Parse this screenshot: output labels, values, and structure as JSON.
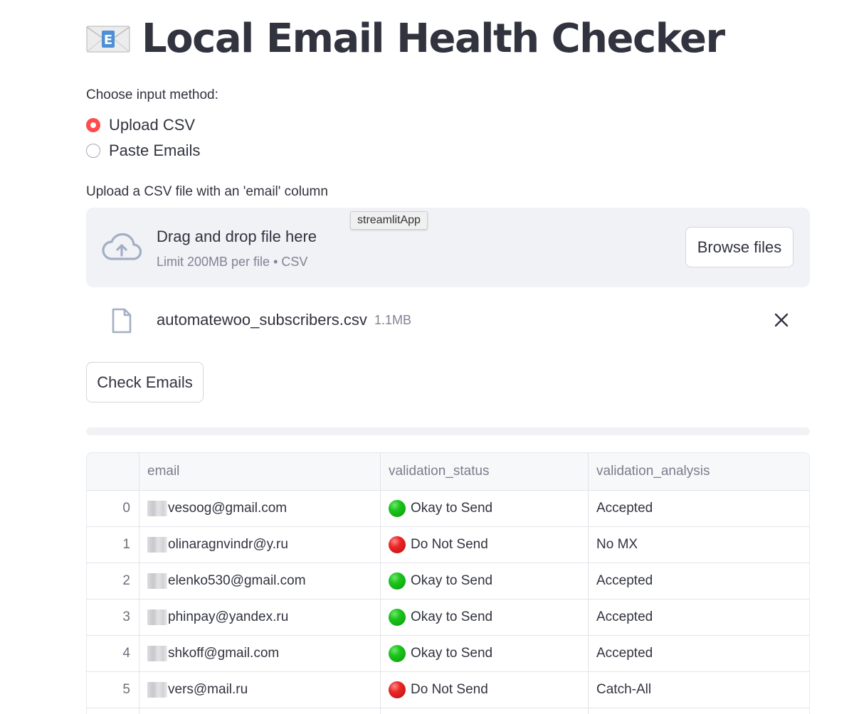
{
  "header": {
    "title": "Local Email Health Checker",
    "icon": "envelope-icon"
  },
  "input_method": {
    "label": "Choose input method:",
    "options": [
      {
        "label": "Upload CSV",
        "selected": true
      },
      {
        "label": "Paste Emails",
        "selected": false
      }
    ]
  },
  "uploader": {
    "label": "Upload a CSV file with an 'email' column",
    "drop_title": "Drag and drop file here",
    "drop_subtitle": "Limit 200MB per file • CSV",
    "browse_label": "Browse files",
    "tooltip": "streamlitApp",
    "file": {
      "name": "automatewoo_subscribers.csv",
      "size": "1.1MB"
    }
  },
  "actions": {
    "check_label": "Check Emails"
  },
  "table": {
    "columns": [
      "",
      "email",
      "validation_status",
      "validation_analysis"
    ],
    "rows": [
      {
        "index": "0",
        "email": "vesoog@gmail.com",
        "status": "Okay to Send",
        "status_color": "green",
        "analysis": "Accepted"
      },
      {
        "index": "1",
        "email": "olinaragnvindr@y.ru",
        "status": "Do Not Send",
        "status_color": "red",
        "analysis": "No MX"
      },
      {
        "index": "2",
        "email": "elenko530@gmail.com",
        "status": "Okay to Send",
        "status_color": "green",
        "analysis": "Accepted"
      },
      {
        "index": "3",
        "email": "phinpay@yandex.ru",
        "status": "Okay to Send",
        "status_color": "green",
        "analysis": "Accepted"
      },
      {
        "index": "4",
        "email": "shkoff@gmail.com",
        "status": "Okay to Send",
        "status_color": "green",
        "analysis": "Accepted"
      },
      {
        "index": "5",
        "email": "vers@mail.ru",
        "status": "Do Not Send",
        "status_color": "red",
        "analysis": "Catch-All"
      }
    ]
  },
  "colors": {
    "accent": "#ff4b4b",
    "text": "#31333f",
    "muted": "#808495",
    "panel": "#f0f2f6"
  }
}
